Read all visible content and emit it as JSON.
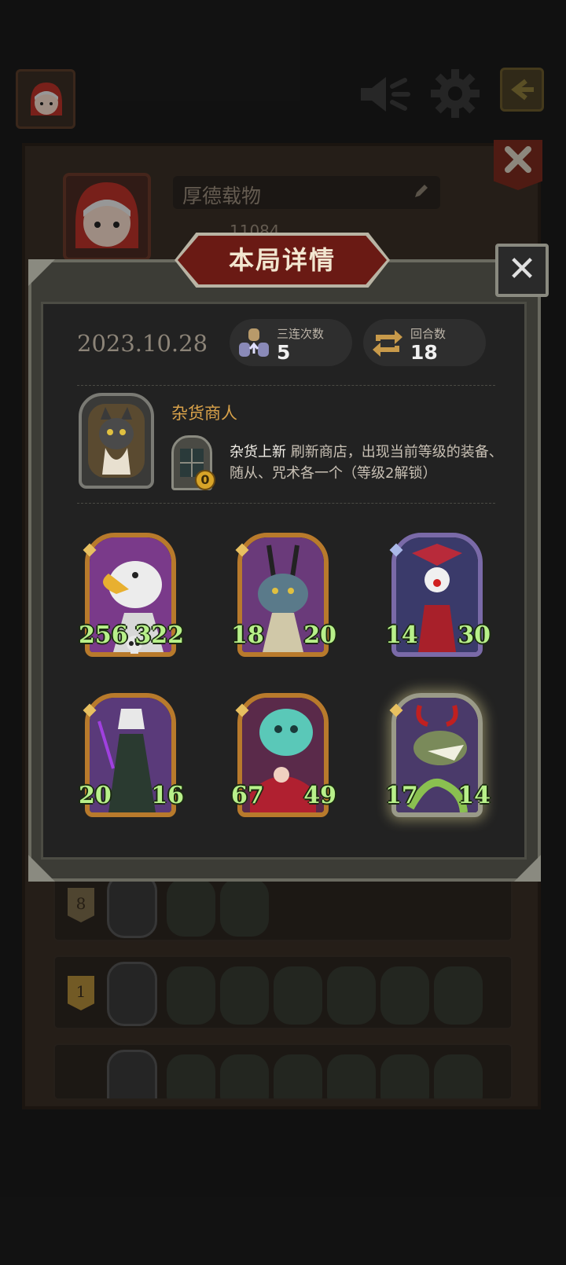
{
  "background": {
    "player_name": "厚德载物",
    "player_score": "11084",
    "history": [
      {
        "rank": "8",
        "units": 2
      },
      {
        "rank": "1",
        "units": 6
      },
      {
        "rank": "",
        "units": 6
      }
    ]
  },
  "modal": {
    "title": "本局详情",
    "close_label": "✕",
    "date": "2023.10.28",
    "stats": [
      {
        "label": "三连次数",
        "value": "5"
      },
      {
        "label": "回合数",
        "value": "18"
      }
    ],
    "hero": {
      "name": "杂货商人",
      "skill_cost": "0",
      "skill_name": "杂货上新",
      "skill_desc": " 刷新商店，出现当前等级的装备、随从、咒术各一个（等级2解锁）"
    },
    "cards": [
      {
        "atk": "256",
        "hp": "322",
        "frame": "gold",
        "skull": true
      },
      {
        "atk": "18",
        "hp": "20",
        "frame": "gold",
        "skull": false
      },
      {
        "atk": "14",
        "hp": "30",
        "frame": "purple",
        "skull": false
      },
      {
        "atk": "20",
        "hp": "16",
        "frame": "gold",
        "skull": false
      },
      {
        "atk": "67",
        "hp": "49",
        "frame": "gold",
        "skull": false
      },
      {
        "atk": "17",
        "hp": "14",
        "frame": "glow",
        "skull": false
      }
    ]
  },
  "colors": {
    "title_banner": "#6a1a14",
    "stat_numbers": "#b8f08a",
    "hero_name": "#d9a24a"
  }
}
